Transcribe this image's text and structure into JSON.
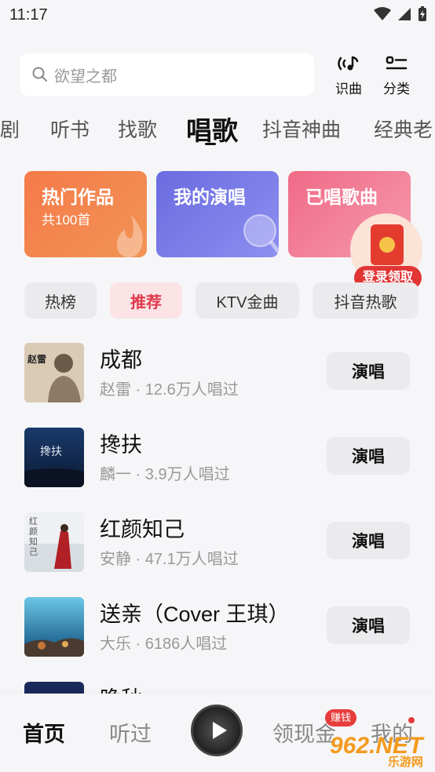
{
  "status_bar": {
    "time": "11:17"
  },
  "search": {
    "placeholder": "欲望之都"
  },
  "top_actions": {
    "recognize": "识曲",
    "category": "分类"
  },
  "tabs": [
    "剧",
    "听书",
    "找歌",
    "唱歌",
    "抖音神曲",
    "经典老"
  ],
  "active_tab": "唱歌",
  "cards": [
    {
      "title": "热门作品",
      "subtitle": "共100首"
    },
    {
      "title": "我的演唱"
    },
    {
      "title": "已唱歌曲"
    }
  ],
  "redpack": {
    "label": "登录领取"
  },
  "chips": [
    "热榜",
    "推荐",
    "KTV金曲",
    "抖音热歌"
  ],
  "selected_chip": "推荐",
  "songs": [
    {
      "title": "成都",
      "meta": "赵雷 · 12.6万人唱过",
      "button": "演唱"
    },
    {
      "title": "搀扶",
      "meta": "麟一 · 3.9万人唱过",
      "button": "演唱"
    },
    {
      "title": "红颜知己",
      "meta": "安静 · 47.1万人唱过",
      "button": "演唱"
    },
    {
      "title": "送亲（Cover 王琪）",
      "meta": "大乐 · 6186人唱过",
      "button": "演唱"
    },
    {
      "title": "晚秋"
    }
  ],
  "cover_texts": {
    "song1": "赵雷",
    "song2": "搀扶",
    "song3": "红颜知己"
  },
  "bottom_nav": {
    "home": "首页",
    "listened": "听过",
    "earn": "领现金",
    "mine": "我的",
    "earn_badge": "赚钱"
  },
  "watermark": {
    "main": "962.NET",
    "sub": "乐游网"
  },
  "colors": {
    "accent_red": "#e03a4c",
    "card_orange": "#f57a4a",
    "card_purple": "#6a6ce0",
    "card_pink": "#f06a86"
  }
}
